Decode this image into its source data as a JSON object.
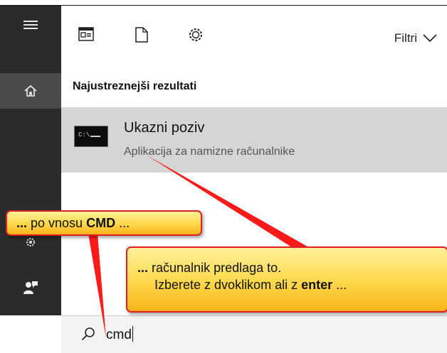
{
  "toolbar": {
    "filters_label": "Filtri"
  },
  "results": {
    "section_title": "Najustreznejši rezultati",
    "best_match": {
      "title": "Ukazni poziv",
      "subtitle": "Aplikacija za namizne računalnike"
    }
  },
  "search": {
    "value": "cmd"
  },
  "callouts": {
    "left": {
      "lead": "...",
      "text": " po vnosu ",
      "bold": "CMD",
      "trail": " ..."
    },
    "right": {
      "lead": "...",
      "line1": " računalnik predlaga to.",
      "line2": "Izberete z dvoklikom ali z ",
      "bold": "enter",
      "trail": " ..."
    }
  },
  "colors": {
    "rail": "#2b2b2b",
    "rail_active": "#4a4a4a",
    "result_highlight": "#d5d5d5",
    "callout_fill": "#ffd84a",
    "callout_border": "#e02020",
    "arrow": "#ff1a1a"
  },
  "icons": [
    "hamburger-menu-icon",
    "home-icon",
    "settings-gear-icon",
    "feedback-icon",
    "apps-icon",
    "documents-icon",
    "web-settings-icon",
    "chevron-down-icon",
    "command-prompt-icon",
    "search-icon"
  ]
}
